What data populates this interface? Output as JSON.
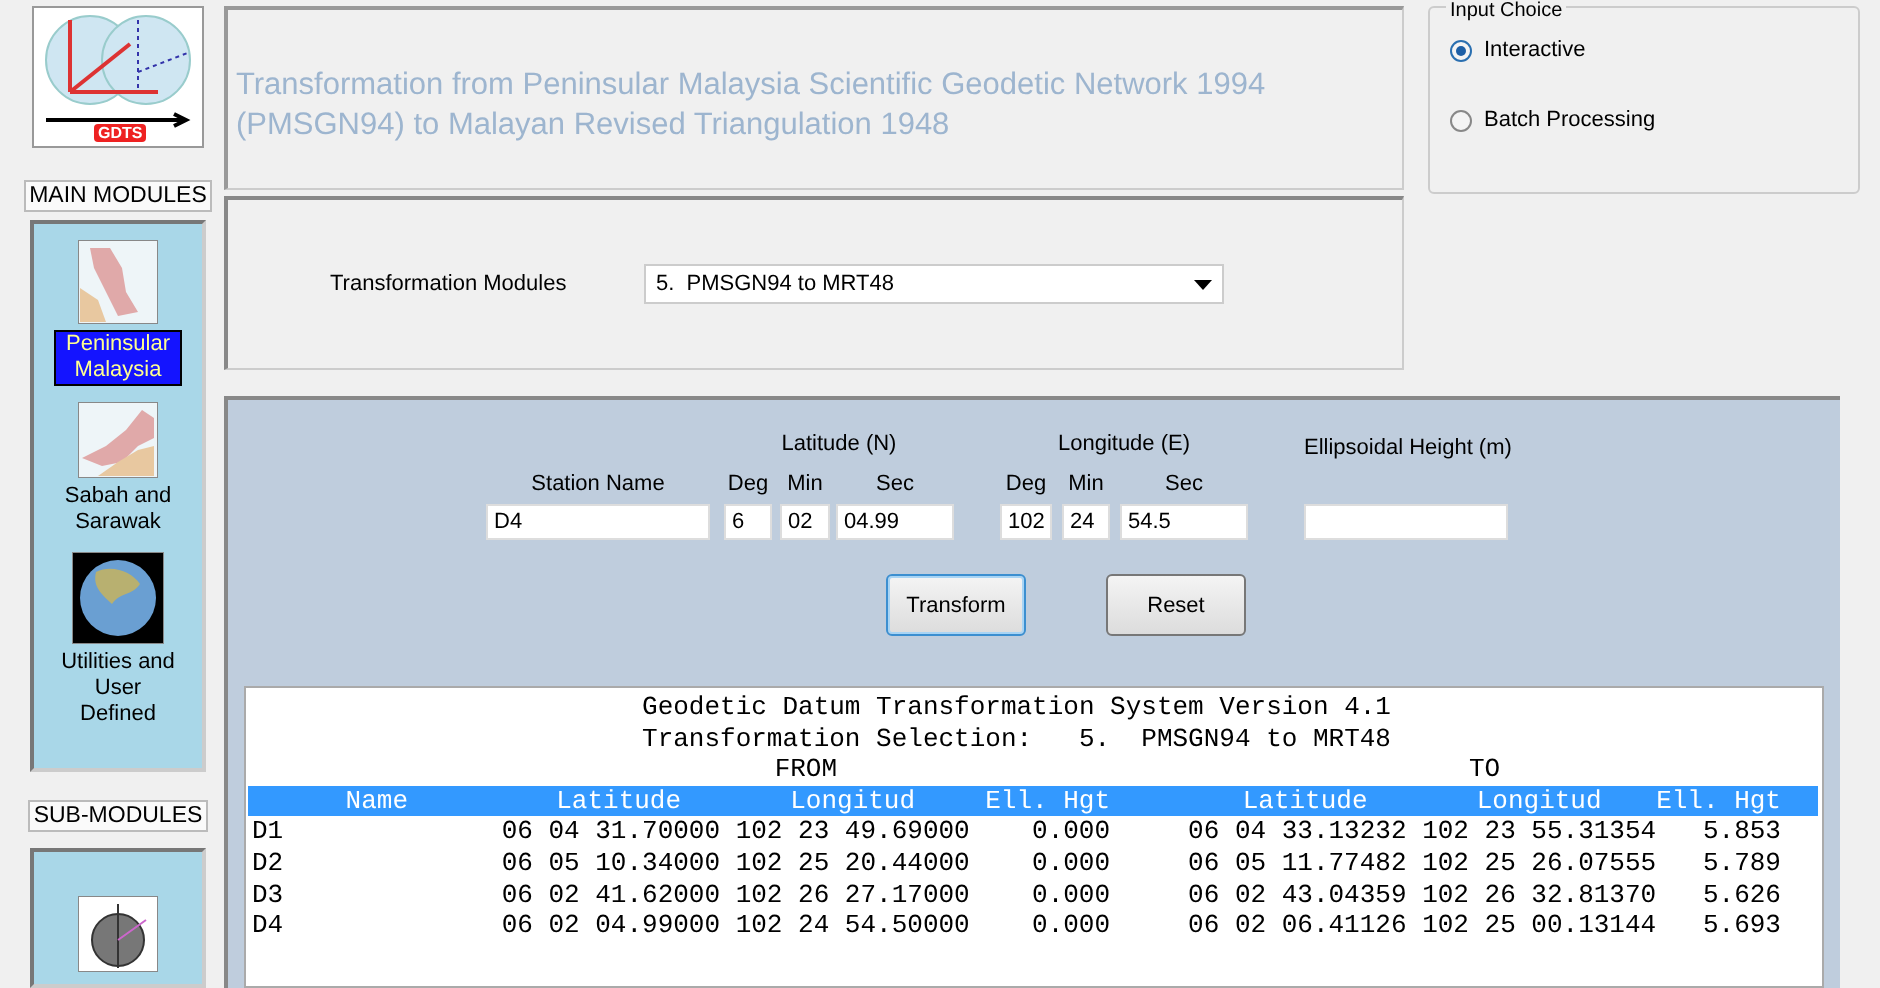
{
  "sidebar": {
    "logo_text": "GDTS",
    "main_modules_label": "MAIN MODULES",
    "modules": [
      {
        "label": "Peninsular Malaysia",
        "kind": "peninsula",
        "selected": true
      },
      {
        "label": "Sabah and Sarawak",
        "kind": "borneo",
        "selected": false
      },
      {
        "label": "Utilities and User Defined",
        "kind": "globe",
        "selected": false
      }
    ],
    "sub_modules_label": "SUB-MODULES"
  },
  "header": {
    "title_lines": [
      "Transformation from Peninsular Malaysia Scientific Geodetic Network 1994",
      "(PMSGN94) to Malayan Revised Triangulation 1948"
    ]
  },
  "input_choice": {
    "title": "Input Choice",
    "options": [
      {
        "label": "Interactive",
        "selected": true
      },
      {
        "label": "Batch Processing",
        "selected": false
      }
    ]
  },
  "modules_selector": {
    "label": "Transformation Modules",
    "value": "5.  PMSGN94 to MRT48"
  },
  "form": {
    "station_label": "Station Name",
    "station_value": "D4",
    "latitude": {
      "title": "Latitude (N)",
      "fields": [
        {
          "label": "Deg",
          "value": "6"
        },
        {
          "label": "Min",
          "value": "02"
        },
        {
          "label": "Sec",
          "value": "04.99"
        }
      ]
    },
    "longitude": {
      "title": "Longitude (E)",
      "fields": [
        {
          "label": "Deg",
          "value": "102"
        },
        {
          "label": "Min",
          "value": "24"
        },
        {
          "label": "Sec",
          "value": "54.5"
        }
      ]
    },
    "height_label": "Ellipsoidal Height (m)",
    "buttons": [
      {
        "label": "Transform",
        "kind": "default"
      },
      {
        "label": "Reset",
        "kind": "normal"
      }
    ]
  },
  "output": {
    "title_lines": [
      "Geodetic Datum Transformation System Version 4.1",
      "Transformation Selection:   5.  PMSGN94 to MRT48"
    ],
    "from_label": "FROM",
    "to_label": "TO",
    "columns": [
      "Name",
      "Latitude",
      "Longitud",
      "Ell. Hgt",
      "Latitude",
      "Longitud",
      "Ell. Hgt"
    ],
    "rows": [
      [
        "D1",
        "06 04 31.70000",
        "102 23 49.69000",
        "0.000",
        "06 04 33.13232",
        "102 23 55.31354",
        "5.853"
      ],
      [
        "D2",
        "06 05 10.34000",
        "102 25 20.44000",
        "0.000",
        "06 05 11.77482",
        "102 25 26.07555",
        "5.789"
      ],
      [
        "D3",
        "06 02 41.62000",
        "102 26 27.17000",
        "0.000",
        "06 02 43.04359",
        "102 26 32.81370",
        "5.626"
      ],
      [
        "D4",
        "06 02 04.99000",
        "102 24 54.50000",
        "0.000",
        "06 02 06.41126",
        "102 25 00.13144",
        "5.693"
      ]
    ]
  }
}
